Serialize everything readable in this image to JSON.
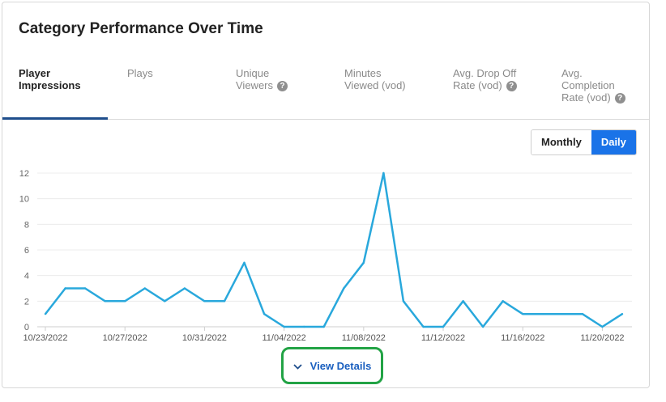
{
  "card": {
    "title": "Category Performance Over Time"
  },
  "tabs": [
    {
      "line1": "Player",
      "line2": "Impressions",
      "line3": "",
      "active": true,
      "help": false
    },
    {
      "line1": "Plays",
      "line2": "",
      "line3": "",
      "active": false,
      "help": false
    },
    {
      "line1": "Unique",
      "line2": "Viewers",
      "line3": "",
      "active": false,
      "help": true
    },
    {
      "line1": "Minutes",
      "line2": "Viewed (vod)",
      "line3": "",
      "active": false,
      "help": false
    },
    {
      "line1": "Avg. Drop Off",
      "line2": "Rate (vod)",
      "line3": "",
      "active": false,
      "help": true
    },
    {
      "line1": "Avg.",
      "line2": "Completion",
      "line3": "Rate (vod)",
      "active": false,
      "help": true
    }
  ],
  "help_glyph": "?",
  "toggle": {
    "monthly": "Monthly",
    "daily": "Daily",
    "selected": "daily"
  },
  "view_details": {
    "label": "View Details",
    "icon": "chevron-down-icon"
  },
  "colors": {
    "line": "#29a8dc",
    "accent": "#1a73e8",
    "tab_underline": "#1f4e8c",
    "highlight": "#22a345"
  },
  "chart_data": {
    "type": "line",
    "title": "",
    "xlabel": "",
    "ylabel": "",
    "ylim": [
      0,
      12
    ],
    "yticks": [
      0,
      2,
      4,
      6,
      8,
      10,
      12
    ],
    "grid": true,
    "x": [
      "10/23/2022",
      "10/24/2022",
      "10/25/2022",
      "10/26/2022",
      "10/27/2022",
      "10/28/2022",
      "10/29/2022",
      "10/30/2022",
      "10/31/2022",
      "11/01/2022",
      "11/02/2022",
      "11/03/2022",
      "11/04/2022",
      "11/05/2022",
      "11/06/2022",
      "11/07/2022",
      "11/08/2022",
      "11/09/2022",
      "11/10/2022",
      "11/11/2022",
      "11/12/2022",
      "11/13/2022",
      "11/14/2022",
      "11/15/2022",
      "11/16/2022",
      "11/17/2022",
      "11/18/2022",
      "11/19/2022",
      "11/20/2022",
      "11/21/2022"
    ],
    "xtick_labels": [
      "10/23/2022",
      "10/27/2022",
      "10/31/2022",
      "11/04/2022",
      "11/08/2022",
      "11/12/2022",
      "11/16/2022",
      "11/20/2022"
    ],
    "series": [
      {
        "values": [
          1,
          3,
          3,
          2,
          2,
          3,
          2,
          3,
          2,
          2,
          5,
          1,
          0,
          0,
          0,
          3,
          5,
          12,
          2,
          0,
          0,
          2,
          0,
          2,
          1,
          1,
          1,
          1,
          0,
          1
        ]
      }
    ]
  }
}
